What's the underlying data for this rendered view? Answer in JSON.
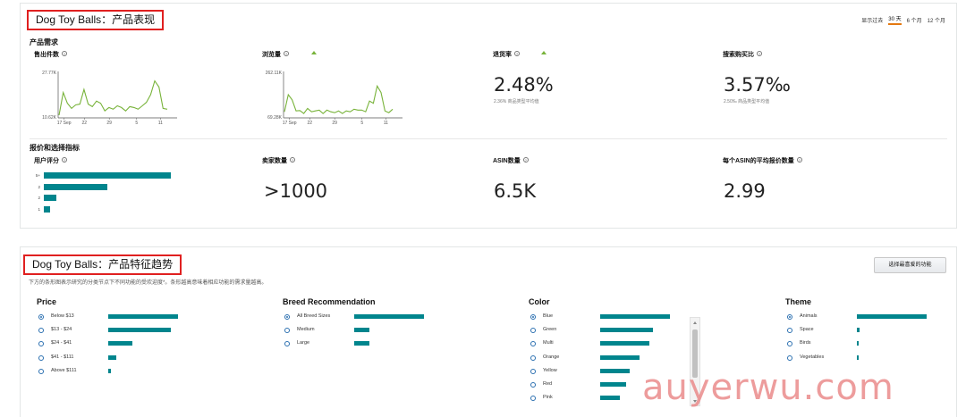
{
  "performance": {
    "title": "Dog Toy Balls：产品表现",
    "range_label": "显示过去",
    "range_options": [
      "30 天",
      "6 个月",
      "12 个月"
    ],
    "active_range": "30 天",
    "demand": {
      "heading": "产品需求",
      "units_sold": {
        "label": "售出件数",
        "y_max": "27.77K",
        "y_min": "10.62K",
        "x_ticks": [
          "17 Sep",
          "22",
          "29",
          "5",
          "11"
        ],
        "series": [
          0.02,
          0.55,
          0.3,
          0.18,
          0.26,
          0.28,
          0.62,
          0.28,
          0.22,
          0.35,
          0.3,
          0.12,
          0.2,
          0.16,
          0.24,
          0.2,
          0.12,
          0.22,
          0.2,
          0.16,
          0.24,
          0.32,
          0.5,
          0.82,
          0.68,
          0.18,
          0.16
        ]
      },
      "page_views": {
        "label": "浏览量",
        "trend": "up",
        "y_max": "262.11K",
        "y_min": "69.28K",
        "x_ticks": [
          "17 Sep",
          "22",
          "29",
          "5",
          "11"
        ],
        "series": [
          0.1,
          0.5,
          0.38,
          0.12,
          0.13,
          0.06,
          0.18,
          0.1,
          0.12,
          0.14,
          0.06,
          0.14,
          0.1,
          0.08,
          0.12,
          0.06,
          0.12,
          0.1,
          0.16,
          0.14,
          0.14,
          0.1,
          0.35,
          0.3,
          0.7,
          0.55,
          0.12,
          0.08,
          0.16
        ]
      },
      "return_rate": {
        "label": "退货率",
        "trend": "up",
        "value": "2.48%",
        "sub": "2.36% 商品类型平均值"
      },
      "search_conversion": {
        "label": "搜索购买比",
        "value": "3.57‰",
        "sub": "2.50‰ 商品类型平均值"
      }
    },
    "pricing": {
      "heading": "报价和选择指标",
      "rating": {
        "label": "用户评分",
        "rows": [
          {
            "star": "5+",
            "share": 1.0
          },
          {
            "star": "2",
            "share": 0.5
          },
          {
            "star": "2",
            "share": 0.1
          },
          {
            "star": "1",
            "share": 0.05
          }
        ]
      },
      "seller_count": {
        "label": "卖家数量",
        "value": ">1000"
      },
      "asin_count": {
        "label": "ASIN数量",
        "value": "6.5K"
      },
      "avg_offers": {
        "label": "每个ASIN的平均报价数量",
        "value": "2.99"
      }
    }
  },
  "trends": {
    "title": "Dog Toy Balls：产品特征趋势",
    "description": "下方的条形图表示研究的分类节点下不同功能的受欢迎度*。条形越高意味着相应功能的需求量越高。",
    "select_button": "选择最喜爱的功能",
    "columns": [
      {
        "title": "Price",
        "items": [
          {
            "label": "Below $13",
            "share": 1.0,
            "checked": true
          },
          {
            "label": "$13 - $24",
            "share": 0.9,
            "checked": false
          },
          {
            "label": "$24 - $41",
            "share": 0.34,
            "checked": false
          },
          {
            "label": "$41 - $111",
            "share": 0.12,
            "checked": false
          },
          {
            "label": "Above $111",
            "share": 0.04,
            "checked": false
          }
        ]
      },
      {
        "title": "Breed Recommendation",
        "items": [
          {
            "label": "All Breed Sizes",
            "share": 1.0,
            "checked": true
          },
          {
            "label": "Medium",
            "share": 0.22,
            "checked": false
          },
          {
            "label": "Large",
            "share": 0.22,
            "checked": false
          }
        ]
      },
      {
        "title": "Color",
        "items": [
          {
            "label": "Blue",
            "share": 1.0,
            "checked": true
          },
          {
            "label": "Green",
            "share": 0.75,
            "checked": false
          },
          {
            "label": "Multi",
            "share": 0.7,
            "checked": false
          },
          {
            "label": "Orange",
            "share": 0.56,
            "checked": false
          },
          {
            "label": "Yellow",
            "share": 0.42,
            "checked": false
          },
          {
            "label": "Red",
            "share": 0.37,
            "checked": false
          },
          {
            "label": "Pink",
            "share": 0.28,
            "checked": false
          }
        ]
      },
      {
        "title": "Theme",
        "items": [
          {
            "label": "Animals",
            "share": 1.0,
            "checked": true
          },
          {
            "label": "Space",
            "share": 0.04,
            "checked": false
          },
          {
            "label": "Birds",
            "share": 0.03,
            "checked": false
          },
          {
            "label": "Vegetables",
            "share": 0.02,
            "checked": false
          }
        ]
      }
    ]
  },
  "watermark": "auyerwu.com",
  "colors": {
    "accent_bar": "#00858d",
    "sparkline": "#78b33a",
    "highlight_box": "#e02020",
    "active_tab": "#e47911"
  }
}
